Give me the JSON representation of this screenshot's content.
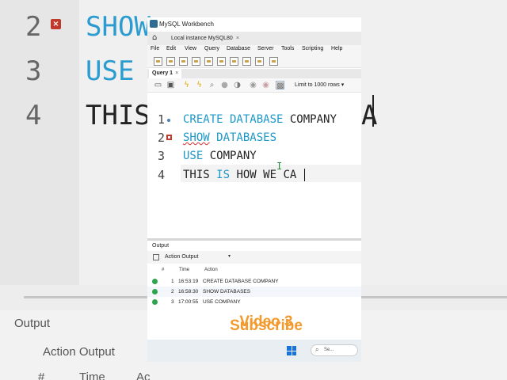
{
  "window": {
    "app_title": "MySQL Workbench",
    "connection_tab": "Local instance MySQL80",
    "tab_close": "×"
  },
  "menu": [
    "File",
    "Edit",
    "View",
    "Query",
    "Database",
    "Server",
    "Tools",
    "Scripting",
    "Help"
  ],
  "query_tab": {
    "label": "Query 1",
    "close": "×"
  },
  "toolbar": {
    "limit_select": "Limit to 1000 rows"
  },
  "editor": {
    "lines": [
      {
        "num": "1",
        "keyword": "CREATE DATABASE",
        "rest": "COMPANY"
      },
      {
        "num": "2",
        "keyword": "SHOW DATABASES",
        "rest": ""
      },
      {
        "num": "3",
        "keyword": "USE",
        "rest": "COMPANY"
      },
      {
        "num": "4",
        "pre": "THIS ",
        "keyword": "IS",
        "rest": "HOW WE CA"
      }
    ]
  },
  "output": {
    "title": "Output",
    "selector": "Action Output",
    "columns": [
      "#",
      "Time",
      "Action"
    ],
    "rows": [
      {
        "num": "1",
        "time": "16:53:19",
        "action": "CREATE DATABASE COMPANY",
        "status": "success"
      },
      {
        "num": "2",
        "time": "16:58:30",
        "action": "SHOW DATABASES",
        "status": "success"
      },
      {
        "num": "3",
        "time": "17:00:55",
        "action": "USE COMPANY",
        "status": "success"
      }
    ]
  },
  "overlay": {
    "line1": "Video 3",
    "line2": "Subscribe"
  },
  "taskbar": {
    "search": "Se..."
  },
  "background": {
    "line_numbers": [
      "2",
      "3",
      "4"
    ],
    "code": [
      "SHOW",
      "USE",
      "THIS"
    ],
    "code_tail": "A",
    "output_title": "Output",
    "action_output": "Action Output",
    "columns": [
      "#",
      "Time",
      "Ac"
    ]
  },
  "colors": {
    "keyword": "#1c98c9",
    "overlay": "#f29a2e",
    "success": "#2ea44f",
    "error_marker": "#c0392b"
  }
}
